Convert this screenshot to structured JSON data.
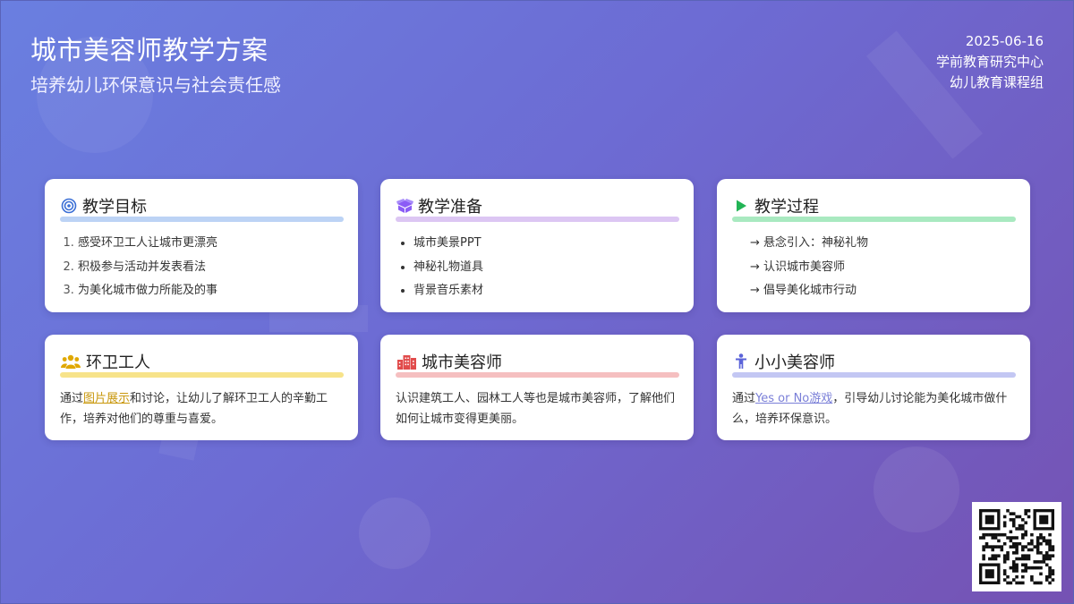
{
  "header": {
    "title": "城市美容师教学方案",
    "subtitle": "培养幼儿环保意识与社会责任感",
    "date": "2025-06-16",
    "org": "学前教育研究中心",
    "group": "幼儿教育课程组"
  },
  "colors": {
    "goal": "#bcd3f5",
    "prep": "#dcc6f3",
    "process": "#a9e9c0",
    "workers": "#f7e38a",
    "city": "#f5bfc0",
    "little": "#c3c7f3",
    "goal_icon": "#3b6fd6",
    "prep_icon": "#8b5cf6",
    "process_icon": "#22b455",
    "workers_icon": "#e0a800",
    "city_icon": "#e14b4b",
    "little_icon": "#5b63d9",
    "link_workers": "#c9980e",
    "link_little": "#7a7fd8"
  },
  "cards": {
    "goal": {
      "title": "教学目标",
      "icon": "target-icon",
      "items": [
        "感受环卫工人让城市更漂亮",
        "积极参与活动并发表看法",
        "为美化城市做力所能及的事"
      ]
    },
    "prep": {
      "title": "教学准备",
      "icon": "box-icon",
      "items": [
        "城市美景PPT",
        "神秘礼物道具",
        "背景音乐素材"
      ]
    },
    "process": {
      "title": "教学过程",
      "icon": "play-icon",
      "items": [
        "→ 悬念引入：神秘礼物",
        "→ 认识城市美容师",
        "→ 倡导美化城市行动"
      ]
    },
    "workers": {
      "title": "环卫工人",
      "icon": "people-icon",
      "text_before": "通过",
      "link": "图片展示",
      "text_after": "和讨论，让幼儿了解环卫工人的辛勤工作，培养对他们的尊重与喜爱。"
    },
    "city": {
      "title": "城市美容师",
      "icon": "city-icon",
      "text": "认识建筑工人、园林工人等也是城市美容师，了解他们如何让城市变得更美丽。"
    },
    "little": {
      "title": "小小美容师",
      "icon": "child-icon",
      "text_before": "通过",
      "link": "Yes or No游戏",
      "text_after": "，引导幼儿讨论能为美化城市做什么，培养环保意识。"
    }
  },
  "qr": {
    "icon": "qr-code-icon"
  }
}
